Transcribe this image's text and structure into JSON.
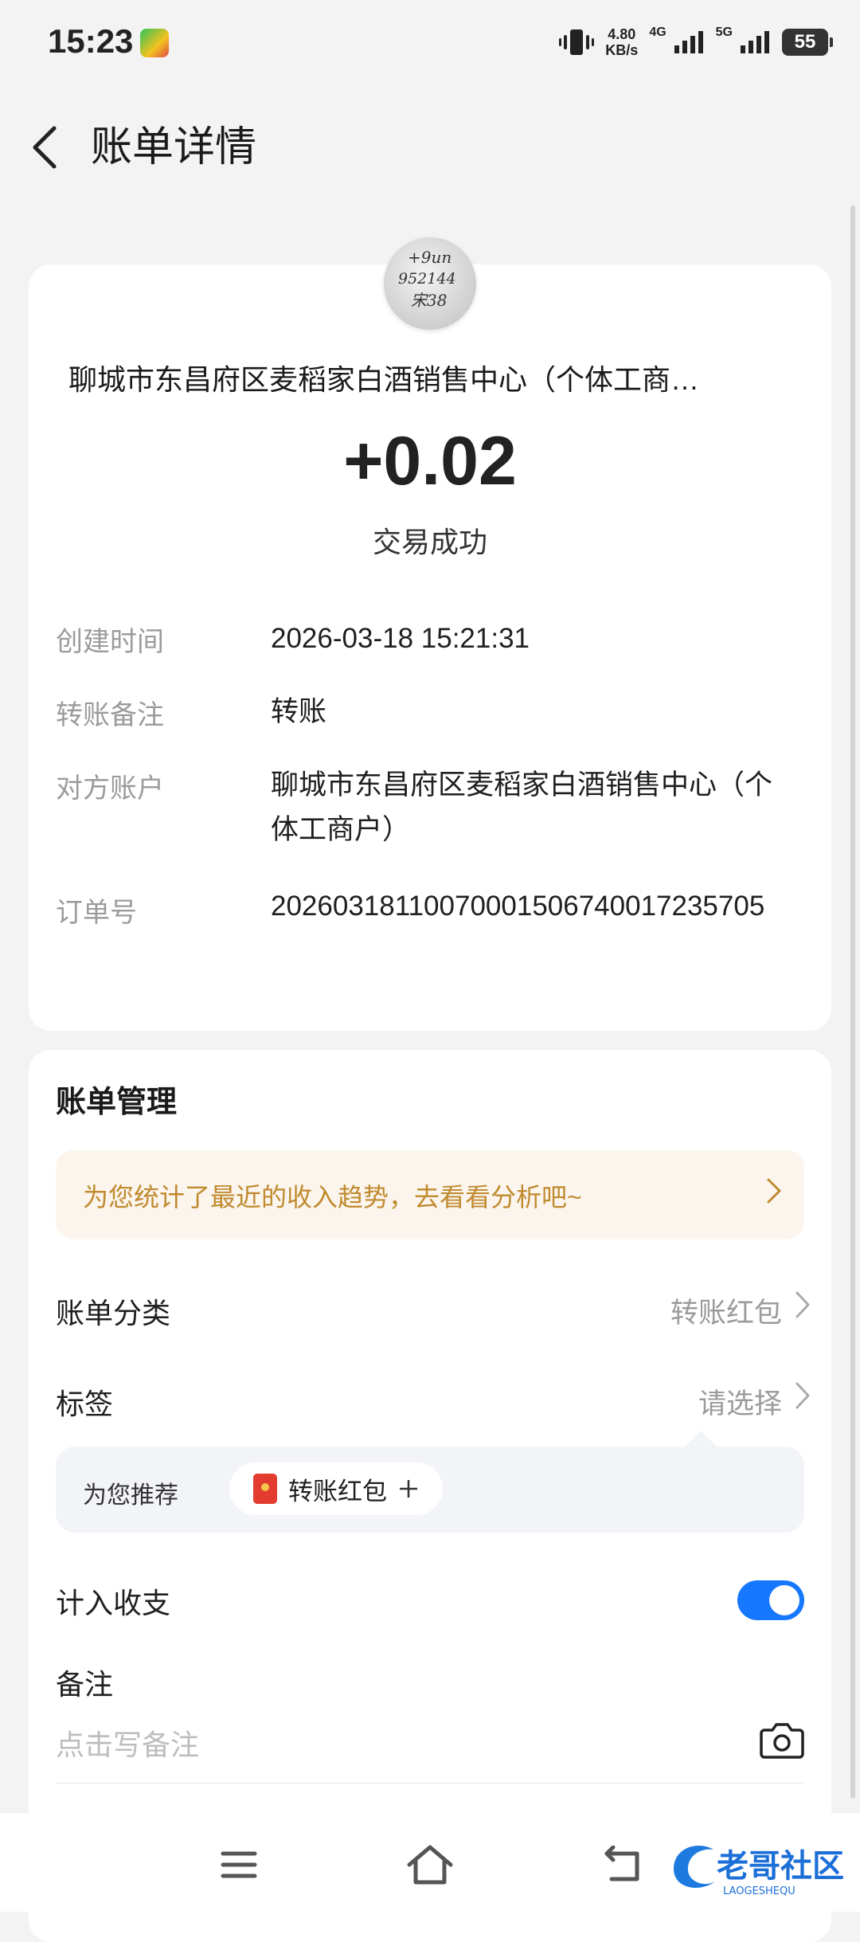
{
  "status_bar": {
    "time": "15:23",
    "net_speed": "4.80",
    "net_unit": "KB/s",
    "signal1_label": "4G",
    "signal2_label": "5G",
    "battery": "55"
  },
  "header": {
    "title": "账单详情"
  },
  "avatar": {
    "handwriting_line1": "+9un",
    "handwriting_line2": "952144",
    "handwriting_line3": "宋38"
  },
  "transaction": {
    "merchant": "聊城市东昌府区麦稻家白酒销售中心（个体工商…",
    "amount": "+0.02",
    "status": "交易成功"
  },
  "details": [
    {
      "label": "创建时间",
      "value": "2026-03-18 15:21:31"
    },
    {
      "label": "转账备注",
      "value": "转账"
    },
    {
      "label": "对方账户",
      "value": "聊城市东昌府区麦稻家白酒销售中心（个体工商户）"
    },
    {
      "label": "订单号",
      "value": "20260318110070001506740017235705"
    }
  ],
  "management": {
    "title": "账单管理",
    "banner_text": "为您统计了最近的收入趋势，去看看分析吧~",
    "category_label": "账单分类",
    "category_value": "转账红包",
    "tag_label": "标签",
    "tag_value": "请选择",
    "recommend_label": "为您推荐",
    "recommend_chip": "转账红包",
    "include_label": "计入收支",
    "include_enabled": true,
    "note_label": "备注",
    "note_placeholder": "点击写备注"
  },
  "watermark": {
    "text": "老哥社区",
    "subtext": "LAOGESHEQU"
  },
  "colors": {
    "accent": "#1677ff",
    "banner_text": "#c08a2d",
    "background": "#f3f3f3"
  }
}
